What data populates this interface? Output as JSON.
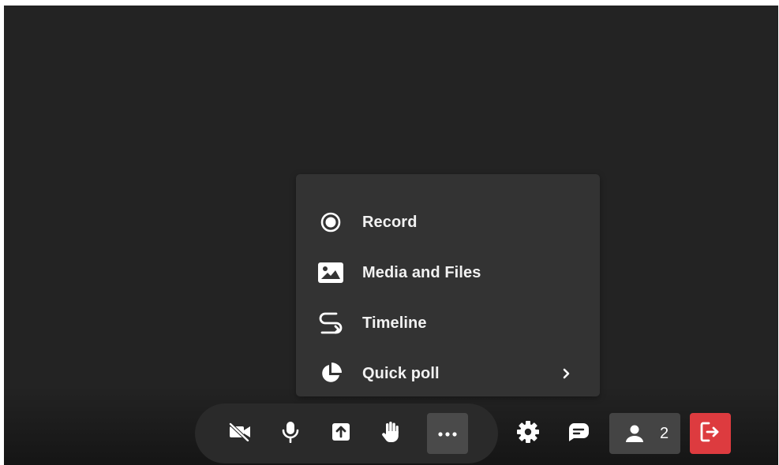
{
  "menu": {
    "items": [
      {
        "icon": "record-icon",
        "label": "Record"
      },
      {
        "icon": "image-icon",
        "label": "Media and Files"
      },
      {
        "icon": "timeline-icon",
        "label": "Timeline"
      },
      {
        "icon": "pie-chart-icon",
        "label": "Quick poll",
        "has_submenu": true
      }
    ]
  },
  "toolbar": {
    "buttons": [
      {
        "icon": "video-off-icon"
      },
      {
        "icon": "microphone-icon"
      },
      {
        "icon": "share-screen-icon"
      },
      {
        "icon": "raise-hand-icon"
      },
      {
        "icon": "more-options-icon",
        "active": true
      }
    ]
  },
  "controls": {
    "settings_icon": "gear-icon",
    "chat_icon": "chat-icon",
    "participants_icon": "person-icon",
    "participants_count": "2",
    "leave_icon": "leave-icon"
  },
  "colors": {
    "background": "#232323",
    "menu_background": "#333333",
    "active_button": "#4a4a4a",
    "participants_button": "#444444",
    "leave_button": "#dd3b3f",
    "icon": "#ffffff"
  }
}
